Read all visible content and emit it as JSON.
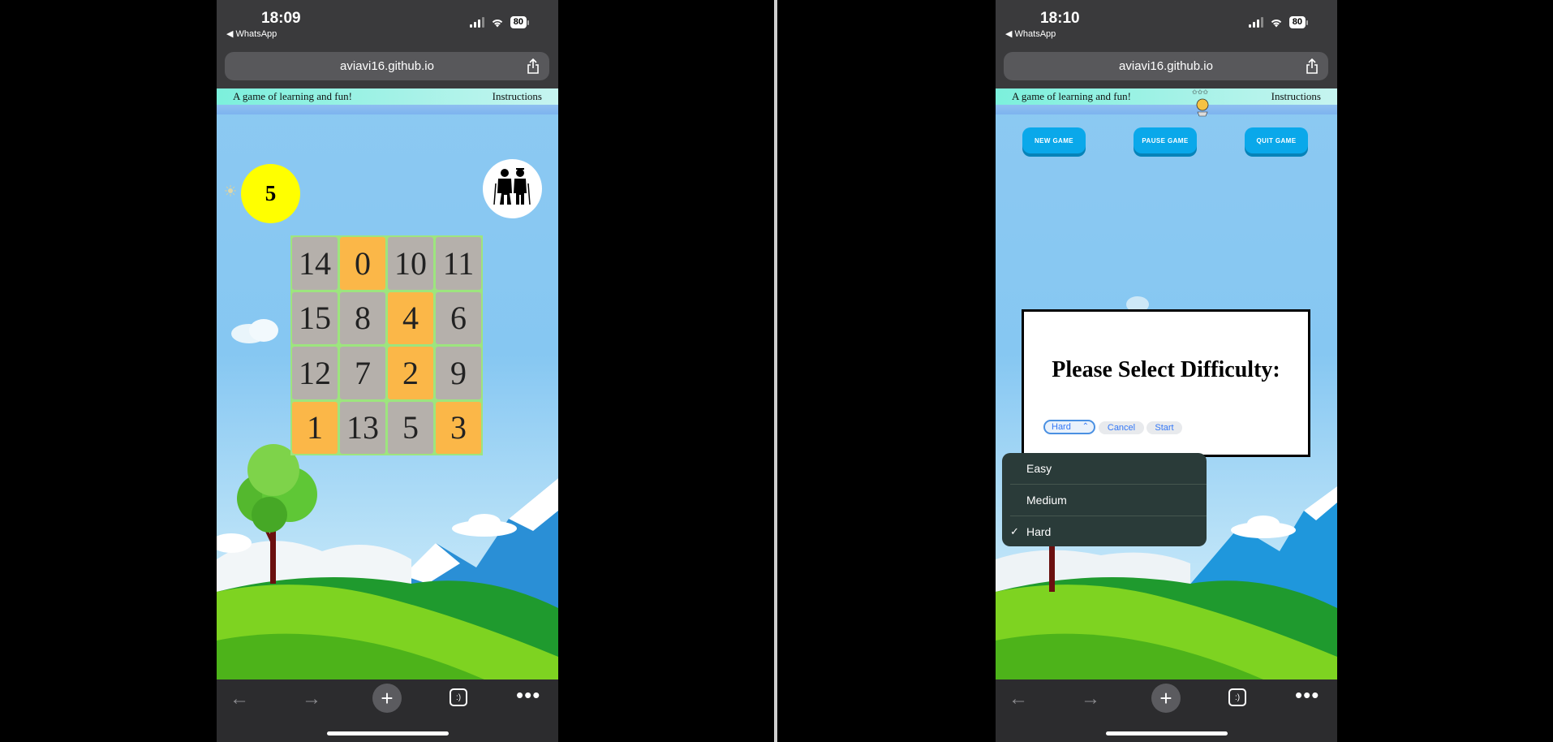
{
  "left_screen": {
    "status": {
      "time": "18:09",
      "back_app": "◀ WhatsApp",
      "battery": "80"
    },
    "url": "aviavi16.github.io",
    "header": {
      "tagline": "A game of learning and fun!",
      "instructions": "Instructions"
    },
    "sun_value": "5",
    "grid": [
      [
        {
          "v": "14",
          "c": "gray"
        },
        {
          "v": "0",
          "c": "orange"
        },
        {
          "v": "10",
          "c": "gray"
        },
        {
          "v": "11",
          "c": "gray"
        }
      ],
      [
        {
          "v": "15",
          "c": "gray"
        },
        {
          "v": "8",
          "c": "gray"
        },
        {
          "v": "4",
          "c": "orange"
        },
        {
          "v": "6",
          "c": "gray"
        }
      ],
      [
        {
          "v": "12",
          "c": "gray"
        },
        {
          "v": "7",
          "c": "gray"
        },
        {
          "v": "2",
          "c": "orange"
        },
        {
          "v": "9",
          "c": "gray"
        }
      ],
      [
        {
          "v": "1",
          "c": "orange"
        },
        {
          "v": "13",
          "c": "gray"
        },
        {
          "v": "5",
          "c": "gray"
        },
        {
          "v": "3",
          "c": "orange"
        }
      ]
    ],
    "toolbar": {
      "back": "←",
      "forward": "→",
      "new_tab": "+",
      "tabs": ":)",
      "more": "•••"
    }
  },
  "right_screen": {
    "status": {
      "time": "18:10",
      "back_app": "◀ WhatsApp",
      "battery": "80"
    },
    "url": "aviavi16.github.io",
    "header": {
      "tagline": "A game of learning and fun!",
      "instructions": "Instructions"
    },
    "buttons": {
      "new_game": "NEW GAME",
      "pause_game": "PAUSE GAME",
      "quit_game": "QUIT GAME"
    },
    "dialog": {
      "title": "Please Select Difficulty:",
      "selected": "Hard",
      "cancel": "Cancel",
      "start": "Start"
    },
    "dropdown_options": [
      {
        "label": "Easy",
        "checked": false
      },
      {
        "label": "Medium",
        "checked": false
      },
      {
        "label": "Hard",
        "checked": true
      }
    ],
    "toolbar": {
      "back": "←",
      "forward": "→",
      "new_tab": "+",
      "tabs": ":)",
      "more": "•••"
    }
  },
  "colors": {
    "tile_gray": "#b5b0ab",
    "tile_orange": "#fbb748",
    "sun": "#ffff00",
    "game_button": "#0aa8ea"
  }
}
